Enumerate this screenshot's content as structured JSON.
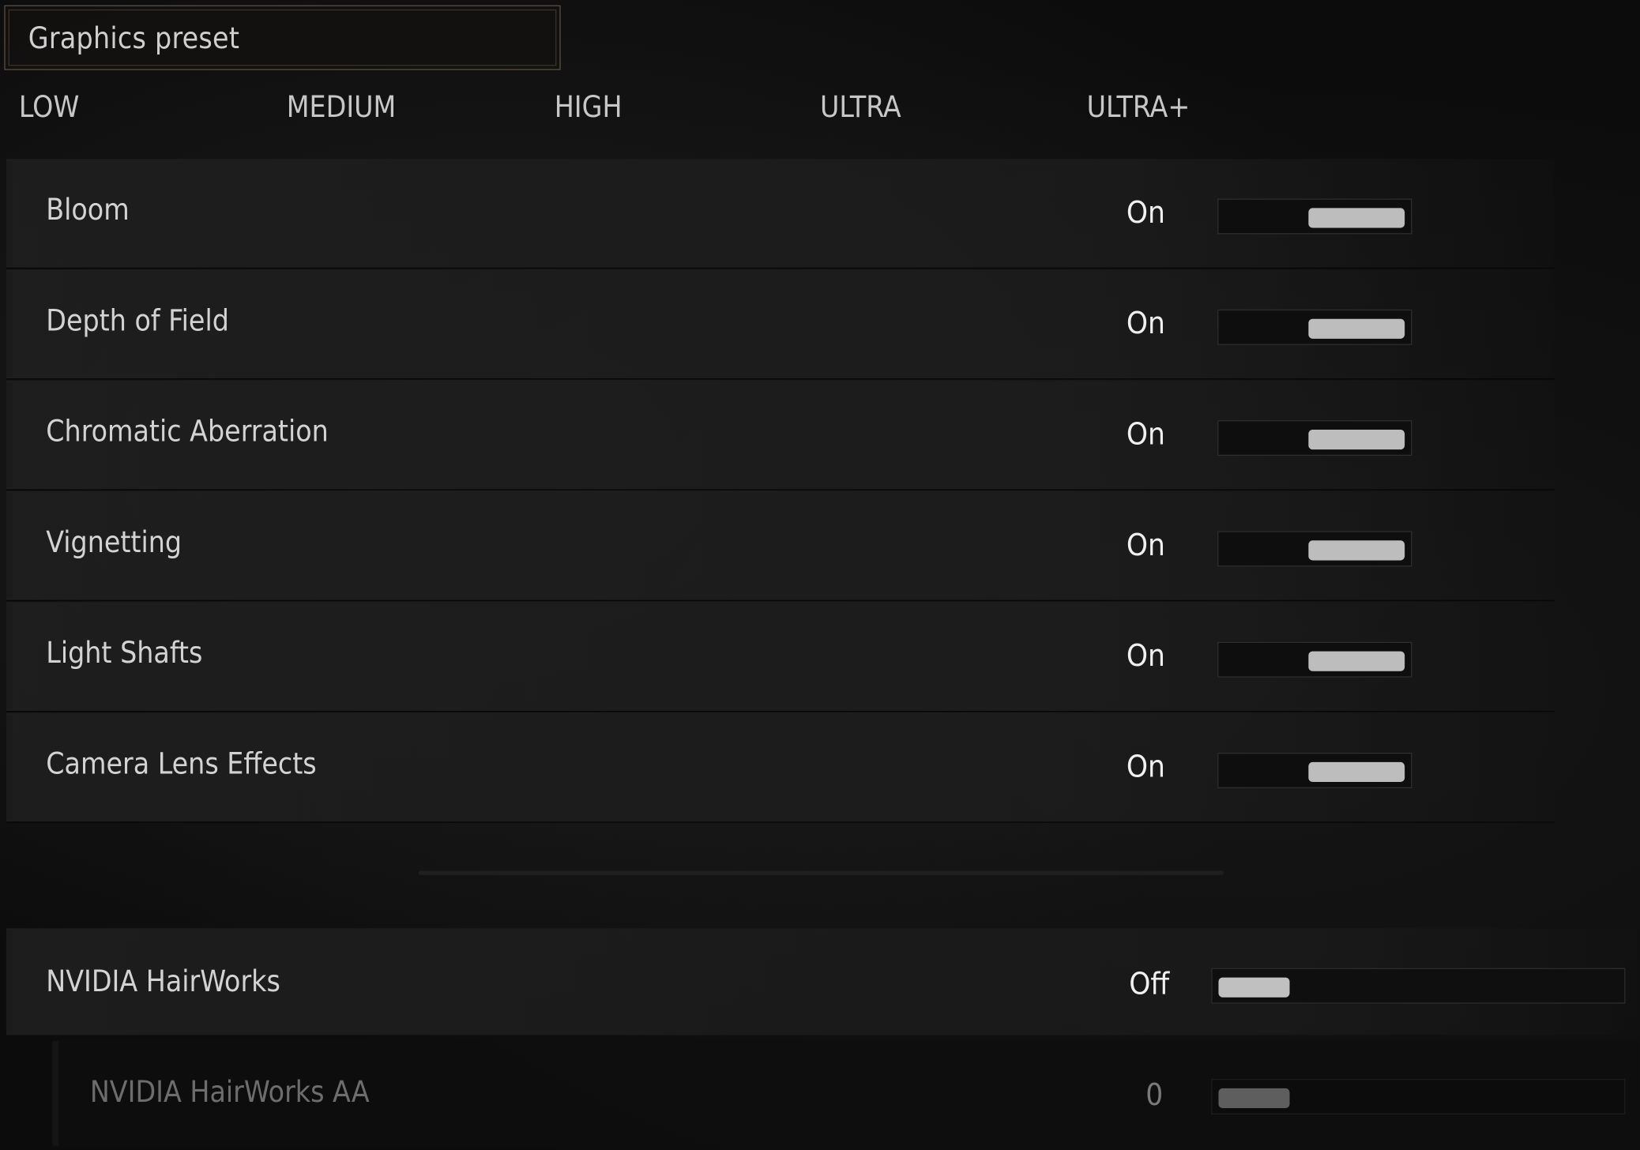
{
  "preset": {
    "label": "Graphics preset",
    "levels": [
      "LOW",
      "MEDIUM",
      "HIGH",
      "ULTRA",
      "ULTRA+"
    ]
  },
  "settings": [
    {
      "label": "Bloom",
      "value": "On",
      "enabled": true
    },
    {
      "label": "Depth of Field",
      "value": "On",
      "enabled": true
    },
    {
      "label": "Chromatic Aberration",
      "value": "On",
      "enabled": true
    },
    {
      "label": "Vignetting",
      "value": "On",
      "enabled": true
    },
    {
      "label": "Light Shafts",
      "value": "On",
      "enabled": true
    },
    {
      "label": "Camera Lens Effects",
      "value": "On",
      "enabled": true
    }
  ],
  "hairworks": {
    "label": "NVIDIA HairWorks",
    "value": "Off"
  },
  "hairworks_aa": {
    "label": "NVIDIA HairWorks AA",
    "value": "0"
  }
}
